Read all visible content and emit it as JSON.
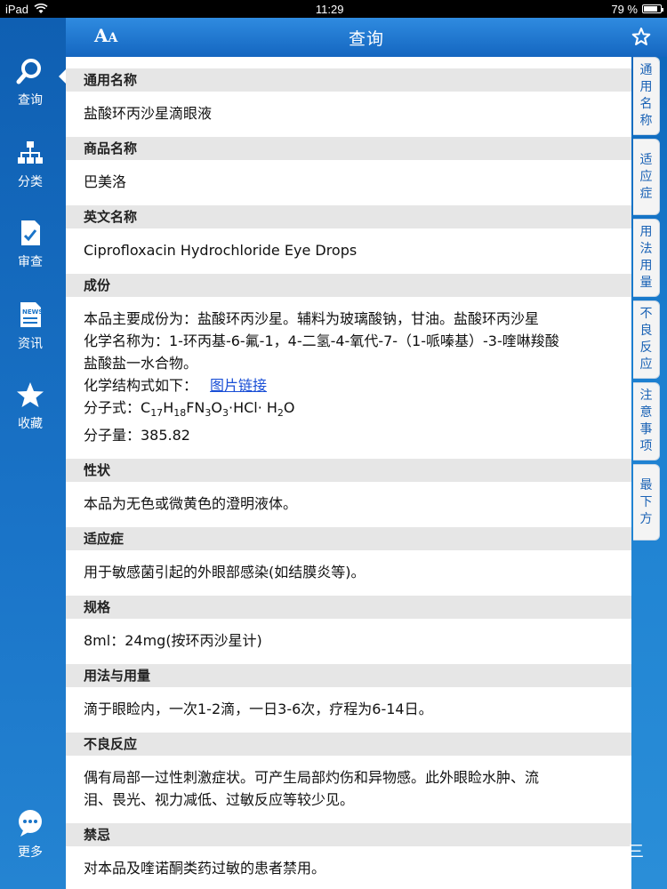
{
  "status": {
    "device": "iPad",
    "time": "11:29",
    "battery": "79 %",
    "battery_level": 0.79
  },
  "titlebar": {
    "title": "查询",
    "font_button": "A",
    "font_button_small": "A"
  },
  "sidebar": {
    "items": [
      {
        "label": "查询",
        "icon": "search-icon"
      },
      {
        "label": "分类",
        "icon": "hierarchy-icon"
      },
      {
        "label": "审查",
        "icon": "document-check-icon"
      },
      {
        "label": "资讯",
        "icon": "news-icon"
      },
      {
        "label": "收藏",
        "icon": "star-icon"
      },
      {
        "label": "更多",
        "icon": "chat-bubble-icon"
      }
    ],
    "news_badge": "NEWS"
  },
  "sections": {
    "generic_name": {
      "title": "通用名称",
      "text": "盐酸环丙沙星滴眼液"
    },
    "brand_name": {
      "title": "商品名称",
      "text": "巴美洛"
    },
    "english_name": {
      "title": "英文名称",
      "text": "Ciprofloxacin Hydrochloride Eye Drops"
    },
    "composition": {
      "title": "成份",
      "line1": "本品主要成份为：盐酸环丙沙星。辅料为玻璃酸钠，甘油。盐酸环丙沙星",
      "line2": "化学名称为：1-环丙基-6-氟-1，4-二氢-4-氧代-7-（1-哌嗪基）-3-喹啉羧酸",
      "line3": "盐酸盐一水合物。",
      "structure_label": "化学结构式如下：",
      "structure_link": "图片链接",
      "formula_label": "分子式：",
      "weight": "分子量：385.82"
    },
    "appearance": {
      "title": "性状",
      "text": "本品为无色或微黄色的澄明液体。"
    },
    "indications": {
      "title": "适应症",
      "text": "用于敏感菌引起的外眼部感染(如结膜炎等)。"
    },
    "specification": {
      "title": "规格",
      "text": "8ml：24mg(按环丙沙星计)"
    },
    "dosage": {
      "title": "用法与用量",
      "text": "滴于眼睑内，一次1-2滴，一日3-6次，疗程为6-14日。"
    },
    "adverse": {
      "title": "不良反应",
      "line1": "偶有局部一过性刺激症状。可产生局部灼伤和异物感。此外眼睑水肿、流",
      "line2": "泪、畏光、视力减低、过敏反应等较少见。"
    },
    "contraindications": {
      "title": "禁忌",
      "text": "对本品及喹诺酮类药过敏的患者禁用。"
    }
  },
  "right_tabs": [
    {
      "chars": [
        "通",
        "用",
        "名",
        "称"
      ]
    },
    {
      "chars": [
        "适",
        "应",
        "症"
      ]
    },
    {
      "chars": [
        "用",
        "法",
        "用",
        "量"
      ]
    },
    {
      "chars": [
        "不",
        "良",
        "反",
        "应"
      ]
    },
    {
      "chars": [
        "注",
        "意",
        "事",
        "项"
      ]
    },
    {
      "chars": [
        "最",
        "下",
        "方"
      ]
    }
  ],
  "corner_mark": "三",
  "colors": {
    "accent": "#1466c0",
    "link": "#1a4fd6",
    "section_header": "#e6e6e6"
  }
}
